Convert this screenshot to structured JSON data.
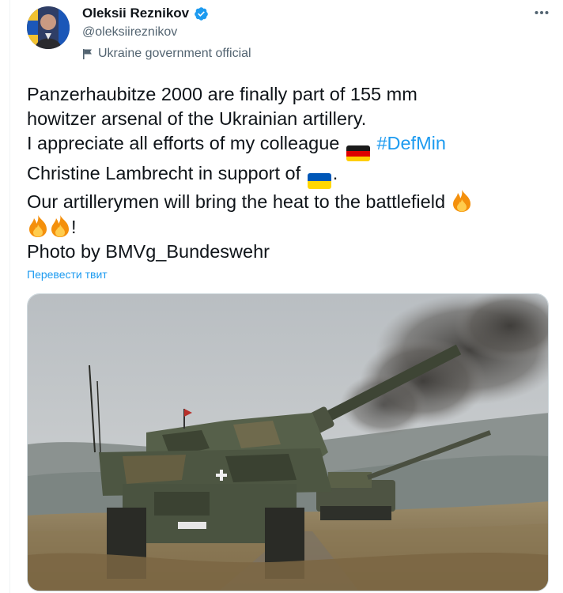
{
  "author": {
    "name": "Oleksii Reznikov",
    "handle": "@oleksiireznikov",
    "label": "Ukraine government official",
    "verified": true
  },
  "tweet": {
    "line1": "Panzerhaubitze 2000 are finally part of 155 mm",
    "line2": "howitzer arsenal of the Ukrainian artillery.",
    "line3_pre": "I appreciate all efforts of my colleague",
    "hashtag": "#DefMin",
    "line4_pre": "Christine Lambrecht in support of",
    "line4_post": ".",
    "line5_pre": "Our artillerymen will bring the heat to the battlefield",
    "line6_post": "!",
    "line7": "Photo by BMVg_Bundeswehr"
  },
  "translate_label": "Перевести твит",
  "icons": {
    "more": "more-icon",
    "verified": "verified-badge-icon",
    "gov_label": "government-flag-icon",
    "germany_flag": "germany-flag-emoji",
    "ukraine_flag": "ukraine-flag-emoji",
    "fire": "fire-emoji"
  },
  "colors": {
    "accent": "#1d9bf0",
    "text": "#0f1419",
    "secondary": "#536471"
  }
}
